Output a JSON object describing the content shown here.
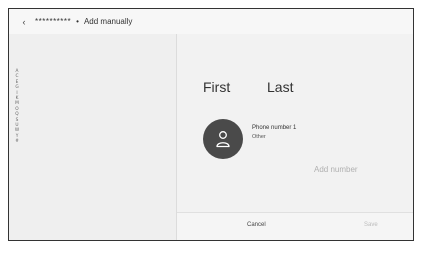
{
  "header": {
    "back_icon": "chevron-left-icon",
    "contact_name": "**********",
    "separator": "•",
    "title": "Add manually"
  },
  "alpha_index": [
    "A",
    "C",
    "E",
    "G",
    "I",
    "K",
    "M",
    "O",
    "Q",
    "S",
    "U",
    "W",
    "Y",
    "#"
  ],
  "contact": {
    "first_name": "First",
    "last_name": "Last",
    "avatar_icon": "person-icon",
    "phone_label": "Phone number 1",
    "phone_type": "Other",
    "add_number": "Add number"
  },
  "footer": {
    "cancel_label": "Cancel",
    "save_label": "Save"
  },
  "colors": {
    "avatar_bg": "#4a4a4a",
    "disabled_text": "#bcbcbc"
  }
}
